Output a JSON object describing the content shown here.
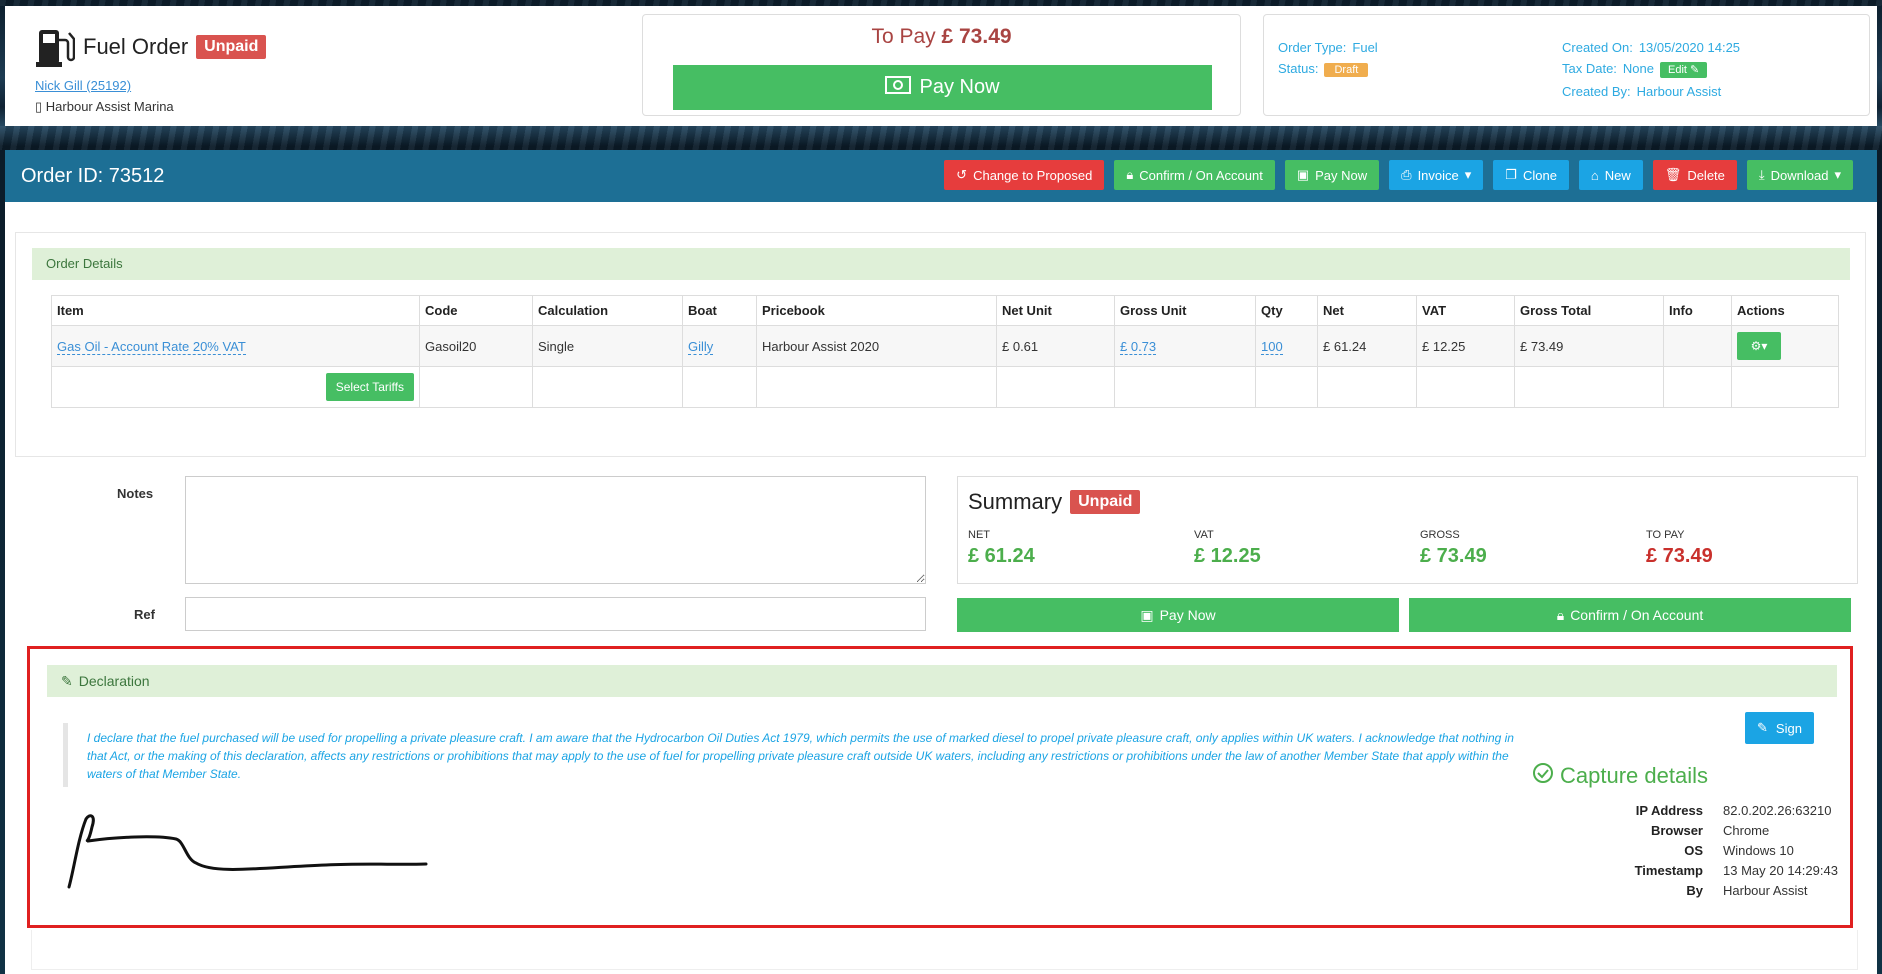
{
  "header": {
    "title": "Fuel Order",
    "status_badge": "Unpaid",
    "customer_link": "Nick Gill (25192)",
    "location": "Harbour Assist Marina"
  },
  "pay": {
    "to_pay_label": "To Pay",
    "to_pay_amount": "£ 73.49",
    "pay_now_label": "Pay Now"
  },
  "info": {
    "order_type_label": "Order Type:",
    "order_type_value": "Fuel",
    "status_label": "Status:",
    "status_value": "Draft",
    "created_on_label": "Created On:",
    "created_on_value": "13/05/2020 14:25",
    "tax_date_label": "Tax Date:",
    "tax_date_value": "None",
    "edit_label": "Edit",
    "created_by_label": "Created By:",
    "created_by_value": "Harbour Assist"
  },
  "order_bar": {
    "order_id": "Order ID: 73512",
    "buttons": {
      "change": "Change to Proposed",
      "confirm": "Confirm / On Account",
      "pay": "Pay Now",
      "invoice": "Invoice",
      "clone": "Clone",
      "new": "New",
      "delete": "Delete",
      "download": "Download"
    }
  },
  "order_details": {
    "heading": "Order Details",
    "columns": [
      "Item",
      "Code",
      "Calculation",
      "Boat",
      "Pricebook",
      "Net Unit",
      "Gross Unit",
      "Qty",
      "Net",
      "VAT",
      "Gross Total",
      "Info",
      "Actions"
    ],
    "row": {
      "item": "Gas Oil - Account Rate 20% VAT",
      "code": "Gasoil20",
      "calculation": "Single",
      "boat": "Gilly",
      "pricebook": "Harbour Assist 2020",
      "net_unit": "£ 0.61",
      "gross_unit": "£ 0.73",
      "qty": "100",
      "net": "£ 61.24",
      "vat": "£ 12.25",
      "gross_total": "£ 73.49",
      "info": ""
    },
    "select_tariffs": "Select Tariffs"
  },
  "form": {
    "notes_label": "Notes",
    "notes_value": "",
    "ref_label": "Ref",
    "ref_value": ""
  },
  "summary": {
    "title": "Summary",
    "badge": "Unpaid",
    "net_label": "NET",
    "net_value": "£ 61.24",
    "vat_label": "VAT",
    "vat_value": "£ 12.25",
    "gross_label": "GROSS",
    "gross_value": "£ 73.49",
    "topay_label": "TO PAY",
    "topay_value": "£ 73.49",
    "pay_now": "Pay Now",
    "confirm": "Confirm / On Account"
  },
  "declaration": {
    "heading": "Declaration",
    "text": "I declare that the fuel purchased will be used for propelling a private pleasure craft. I am aware that the Hydrocarbon Oil Duties Act 1979, which permits the use of marked diesel to propel private pleasure craft, only applies within UK waters. I acknowledge that nothing in that Act, or the making of this declaration, affects any restrictions or prohibitions that may apply to the use of fuel for propelling private pleasure craft outside UK waters, including any restrictions or prohibitions under the law of another Member State that apply within the waters of that Member State.",
    "sign_label": "Sign",
    "capture_title": "Capture details",
    "capture": [
      {
        "k": "IP Address",
        "v": "82.0.202.26:63210"
      },
      {
        "k": "Browser",
        "v": "Chrome"
      },
      {
        "k": "OS",
        "v": "Windows 10"
      },
      {
        "k": "Timestamp",
        "v": "13 May 20 14:29:43"
      },
      {
        "k": "By",
        "v": "Harbour Assist"
      }
    ]
  },
  "colors": {
    "green": "#46be63",
    "red": "#e63d3d",
    "blue": "#1ba4e4",
    "bar": "#1d6f95"
  }
}
